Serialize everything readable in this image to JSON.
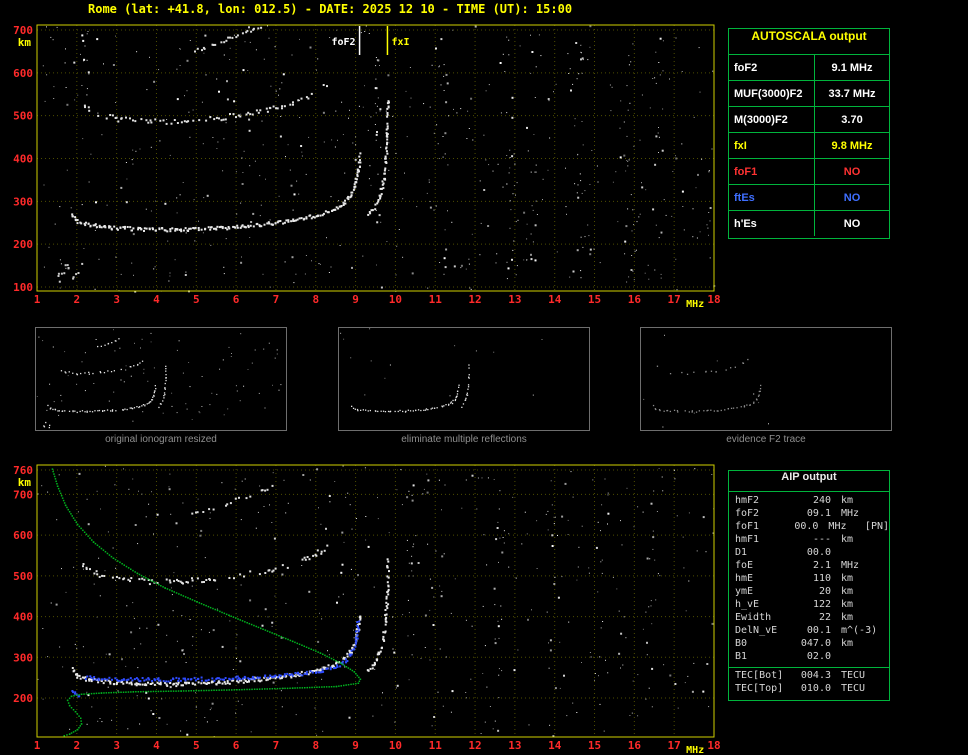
{
  "title": "Rome (lat: +41.8, lon: 012.5) - DATE: 2025 12 10 - TIME (UT): 15:00",
  "colors": {
    "background": "#000000",
    "title_text": "#ffff00",
    "axis_tick": "#ff2a2a",
    "axis_unit": "#ffff00",
    "grid": "#4e4e00",
    "plot_border": "#cfcf00",
    "table_border": "#00b43c",
    "caption_text": "#8f8f8f",
    "trace_white": "#e8e8e8",
    "trace_blue": "#2e4bff",
    "profile_green": "#00b41e",
    "fof1_red": "#ff3232",
    "ftes_blue": "#3f6fff",
    "fxi_yellow": "#ffff00"
  },
  "autoscala_table": {
    "title": "AUTOSCALA output",
    "rows": [
      {
        "label": "foF2",
        "value": "9.1 MHz",
        "color": "#ffffff"
      },
      {
        "label": "MUF(3000)F2",
        "value": "33.7 MHz",
        "color": "#ffffff"
      },
      {
        "label": "M(3000)F2",
        "value": "3.70",
        "color": "#ffffff"
      },
      {
        "label": "fxI",
        "value": "9.8 MHz",
        "color": "#ffff00"
      },
      {
        "label": "foF1",
        "value": "NO",
        "color": "#ff3232"
      },
      {
        "label": "ftEs",
        "value": "NO",
        "color": "#3f6fff"
      },
      {
        "label": "h'Es",
        "value": "NO",
        "color": "#ffffff"
      }
    ]
  },
  "aip_table": {
    "title": "AIP output",
    "rows": [
      {
        "name": "hmF2",
        "value": "240",
        "unit": "km",
        "extra": ""
      },
      {
        "name": "foF2",
        "value": "09.1",
        "unit": "MHz",
        "extra": ""
      },
      {
        "name": "foF1",
        "value": "00.0",
        "unit": "MHz",
        "extra": "[PN]"
      },
      {
        "name": "hmF1",
        "value": "---",
        "unit": "km",
        "extra": ""
      },
      {
        "name": "D1",
        "value": "00.0",
        "unit": "",
        "extra": ""
      },
      {
        "name": "foE",
        "value": "2.1",
        "unit": "MHz",
        "extra": ""
      },
      {
        "name": "hmE",
        "value": "110",
        "unit": "km",
        "extra": ""
      },
      {
        "name": "ymE",
        "value": "20",
        "unit": "km",
        "extra": ""
      },
      {
        "name": "h_vE",
        "value": "122",
        "unit": "km",
        "extra": ""
      },
      {
        "name": "Ewidth",
        "value": "22",
        "unit": "km",
        "extra": ""
      },
      {
        "name": "DelN_vE",
        "value": "00.1",
        "unit": "m^(-3)",
        "extra": ""
      },
      {
        "name": "B0",
        "value": "047.0",
        "unit": "km",
        "extra": ""
      },
      {
        "name": "B1",
        "value": "02.0",
        "unit": "",
        "extra": ""
      }
    ],
    "tec_rows": [
      {
        "name": "TEC[Bot]",
        "value": "004.3",
        "unit": "TECU",
        "extra": ""
      },
      {
        "name": "TEC[Top]",
        "value": "010.0",
        "unit": "TECU",
        "extra": ""
      }
    ]
  },
  "panels": [
    {
      "caption": "original ionogram resized",
      "show": [
        "F2-trace",
        "F2-asymptote",
        "second-hop",
        "third-hop-echo",
        "low-interference"
      ],
      "noise": 85,
      "seed": 21
    },
    {
      "caption": "eliminate multiple reflections",
      "show": [
        "F2-trace",
        "F2-asymptote"
      ],
      "noise": 14,
      "seed": 22
    },
    {
      "caption": "evidence F2 trace",
      "show": [
        "F2-trace",
        "second-hop"
      ],
      "noise": 8,
      "seed": 23,
      "color": "#8c8c8c",
      "step_scale": 2.2
    }
  ],
  "chart_data": [
    {
      "type": "scatter",
      "name": "ionogram-autoscaled",
      "xlabel": "MHz",
      "ylabel": "km",
      "xlim": [
        1,
        18
      ],
      "ylim": [
        100,
        710
      ],
      "xticks": [
        1,
        2,
        3,
        4,
        5,
        6,
        7,
        8,
        9,
        10,
        11,
        12,
        13,
        14,
        15,
        16,
        17,
        18
      ],
      "yticks": [
        700,
        600,
        500,
        400,
        300,
        200,
        100
      ],
      "grid": true,
      "markers": [
        {
          "label": "foF2",
          "f": 9.1,
          "color": "#ffffff",
          "side": "left"
        },
        {
          "label": "fxI",
          "f": 9.8,
          "color": "#ffff00",
          "side": "right"
        }
      ],
      "noise": {
        "seed": 29,
        "count": 480,
        "strips": [
          {
            "f": 9.55,
            "km": [
              420,
              640
            ],
            "n": 18,
            "w": 6
          },
          {
            "f": 12.9,
            "n": 26
          },
          {
            "f": 13.4,
            "n": 18
          },
          {
            "f": 14.6,
            "n": 22
          },
          {
            "f": 15.9,
            "n": 20
          },
          {
            "f": 16.6,
            "n": 18
          },
          {
            "f": 11.2,
            "n": 14
          },
          {
            "f": 2.2,
            "km": [
              560,
              700
            ],
            "n": 12
          }
        ]
      },
      "traces": [
        {
          "name": "F2-trace",
          "color": "#e8e8e8",
          "step": 1.6,
          "size": 2,
          "skip": 0.05,
          "points": [
            [
              1.85,
              272
            ],
            [
              2.0,
              255
            ],
            [
              2.3,
              247
            ],
            [
              2.8,
              241
            ],
            [
              3.5,
              237
            ],
            [
              4.5,
              236
            ],
            [
              5.5,
              239
            ],
            [
              6.2,
              244
            ],
            [
              6.9,
              251
            ],
            [
              7.5,
              259
            ],
            [
              8.0,
              269
            ],
            [
              8.4,
              281
            ],
            [
              8.65,
              295
            ],
            [
              8.85,
              314
            ],
            [
              8.97,
              340
            ],
            [
              9.04,
              372
            ],
            [
              9.09,
              410
            ]
          ]
        },
        {
          "name": "F2-asymptote",
          "color": "#e8e8e8",
          "step": 2,
          "size": 2,
          "skip": 0.15,
          "points": [
            [
              9.3,
              268
            ],
            [
              9.45,
              285
            ],
            [
              9.58,
              310
            ],
            [
              9.68,
              345
            ],
            [
              9.74,
              395
            ],
            [
              9.78,
              460
            ],
            [
              9.8,
              540
            ]
          ]
        },
        {
          "name": "second-hop",
          "color": "#e0e0e0",
          "step": 2.5,
          "size": 2,
          "skip": 0.3,
          "jy": 2.5,
          "points": [
            [
              2.1,
              532
            ],
            [
              2.5,
              507
            ],
            [
              3.0,
              494
            ],
            [
              3.8,
              488
            ],
            [
              4.6,
              489
            ],
            [
              5.4,
              495
            ],
            [
              6.1,
              504
            ],
            [
              6.8,
              516
            ],
            [
              7.4,
              531
            ],
            [
              7.9,
              550
            ],
            [
              8.25,
              572
            ]
          ]
        },
        {
          "name": "third-hop-echo",
          "color": "#dcdcdc",
          "step": 2.5,
          "size": 2,
          "skip": 0.35,
          "points": [
            [
              4.9,
              652
            ],
            [
              5.4,
              668
            ],
            [
              5.9,
              686
            ],
            [
              6.4,
              703
            ],
            [
              6.9,
              720
            ]
          ]
        },
        {
          "name": "low-interference",
          "color": "#c8c8c8",
          "step": 3,
          "size": 2,
          "skip": 0.4,
          "jx": 2,
          "jy": 3,
          "points": [
            [
              1.5,
              115
            ],
            [
              1.6,
              135
            ],
            [
              1.7,
              158
            ],
            [
              1.8,
              150
            ],
            [
              1.9,
              128
            ],
            [
              2.0,
              142
            ]
          ]
        }
      ]
    },
    {
      "type": "scatter",
      "name": "ionogram-with-profile",
      "xlabel": "MHz",
      "ylabel": "km",
      "xlim": [
        1,
        18
      ],
      "ylim": [
        105,
        770
      ],
      "xticks": [
        1,
        2,
        3,
        4,
        5,
        6,
        7,
        8,
        9,
        10,
        11,
        12,
        13,
        14,
        15,
        16,
        17,
        18
      ],
      "yticks": [
        760,
        700,
        600,
        500,
        400,
        300,
        200
      ],
      "grid": true,
      "markers": [],
      "noise": {
        "seed": 57,
        "count": 430,
        "strips": [
          {
            "f": 12.6,
            "n": 20
          },
          {
            "f": 13.9,
            "n": 16
          },
          {
            "f": 15.2,
            "n": 14
          },
          {
            "f": 16.4,
            "n": 16
          },
          {
            "f": 10.4,
            "km": [
              500,
              740
            ],
            "n": 12
          }
        ]
      },
      "traces": [
        {
          "name": "F2-trace",
          "color": "#e8e8e8",
          "step": 1.6,
          "size": 2,
          "skip": 0.05,
          "points": [
            [
              1.85,
              272
            ],
            [
              2.0,
              255
            ],
            [
              2.3,
              247
            ],
            [
              2.8,
              241
            ],
            [
              3.5,
              237
            ],
            [
              4.5,
              236
            ],
            [
              5.5,
              239
            ],
            [
              6.2,
              244
            ],
            [
              6.9,
              251
            ],
            [
              7.5,
              259
            ],
            [
              8.0,
              269
            ],
            [
              8.4,
              281
            ],
            [
              8.65,
              295
            ],
            [
              8.85,
              314
            ],
            [
              8.97,
              340
            ],
            [
              9.04,
              372
            ],
            [
              9.09,
              410
            ]
          ]
        },
        {
          "name": "F2-asymptote",
          "color": "#e8e8e8",
          "step": 2,
          "size": 2,
          "skip": 0.15,
          "points": [
            [
              9.3,
              268
            ],
            [
              9.45,
              285
            ],
            [
              9.58,
              310
            ],
            [
              9.68,
              345
            ],
            [
              9.74,
              395
            ],
            [
              9.78,
              460
            ],
            [
              9.8,
              540
            ]
          ]
        },
        {
          "name": "second-hop",
          "color": "#e0e0e0",
          "step": 2.5,
          "size": 2,
          "skip": 0.3,
          "jy": 2.5,
          "points": [
            [
              2.1,
              532
            ],
            [
              2.5,
              507
            ],
            [
              3.0,
              494
            ],
            [
              3.8,
              488
            ],
            [
              4.6,
              489
            ],
            [
              5.4,
              495
            ],
            [
              6.1,
              504
            ],
            [
              6.8,
              516
            ],
            [
              7.4,
              531
            ],
            [
              7.9,
              550
            ],
            [
              8.25,
              572
            ]
          ]
        },
        {
          "name": "third-hop-echo",
          "color": "#dcdcdc",
          "step": 2.5,
          "size": 2,
          "skip": 0.35,
          "points": [
            [
              4.9,
              652
            ],
            [
              5.4,
              668
            ],
            [
              5.9,
              686
            ],
            [
              6.4,
              703
            ],
            [
              6.9,
              720
            ]
          ]
        },
        {
          "name": "identified-F2-blue",
          "color": "#2e4bff",
          "step": 1.8,
          "size": 2,
          "skip": 0.08,
          "points": [
            [
              2.2,
              252
            ],
            [
              3.0,
              248
            ],
            [
              4.0,
              247
            ],
            [
              5.0,
              248
            ],
            [
              6.0,
              251
            ],
            [
              6.9,
              255
            ],
            [
              7.6,
              261
            ],
            [
              8.1,
              268
            ],
            [
              8.5,
              278
            ],
            [
              8.75,
              294
            ],
            [
              8.92,
              320
            ],
            [
              9.0,
              352
            ],
            [
              9.05,
              392
            ]
          ]
        },
        {
          "name": "E-region-marks-blue",
          "color": "#2e4bff",
          "step": 2,
          "size": 2,
          "skip": 0.2,
          "points": [
            [
              1.82,
              228
            ],
            [
              1.92,
              216
            ],
            [
              2.02,
              206
            ]
          ]
        }
      ],
      "profile": {
        "name": "electron-density-profile",
        "color": "#00b41e",
        "points": [
          [
            1.35,
            770
          ],
          [
            1.5,
            722
          ],
          [
            1.7,
            675
          ],
          [
            2.0,
            628
          ],
          [
            2.4,
            585
          ],
          [
            2.9,
            545
          ],
          [
            3.5,
            508
          ],
          [
            4.2,
            472
          ],
          [
            5.0,
            438
          ],
          [
            5.8,
            405
          ],
          [
            6.6,
            373
          ],
          [
            7.4,
            341
          ],
          [
            8.1,
            312
          ],
          [
            8.6,
            288
          ],
          [
            8.95,
            266
          ],
          [
            9.1,
            248
          ],
          [
            9.05,
            238
          ],
          [
            8.5,
            230
          ],
          [
            7.4,
            226
          ],
          [
            6.0,
            222
          ],
          [
            4.6,
            219
          ],
          [
            3.4,
            217
          ],
          [
            2.6,
            214
          ],
          [
            2.1,
            211
          ],
          [
            1.85,
            206
          ],
          [
            1.75,
            196
          ],
          [
            1.8,
            183
          ],
          [
            1.95,
            168
          ],
          [
            2.08,
            152
          ],
          [
            2.1,
            138
          ],
          [
            2.0,
            124
          ],
          [
            1.8,
            113
          ],
          [
            1.6,
            107
          ]
        ]
      }
    }
  ]
}
